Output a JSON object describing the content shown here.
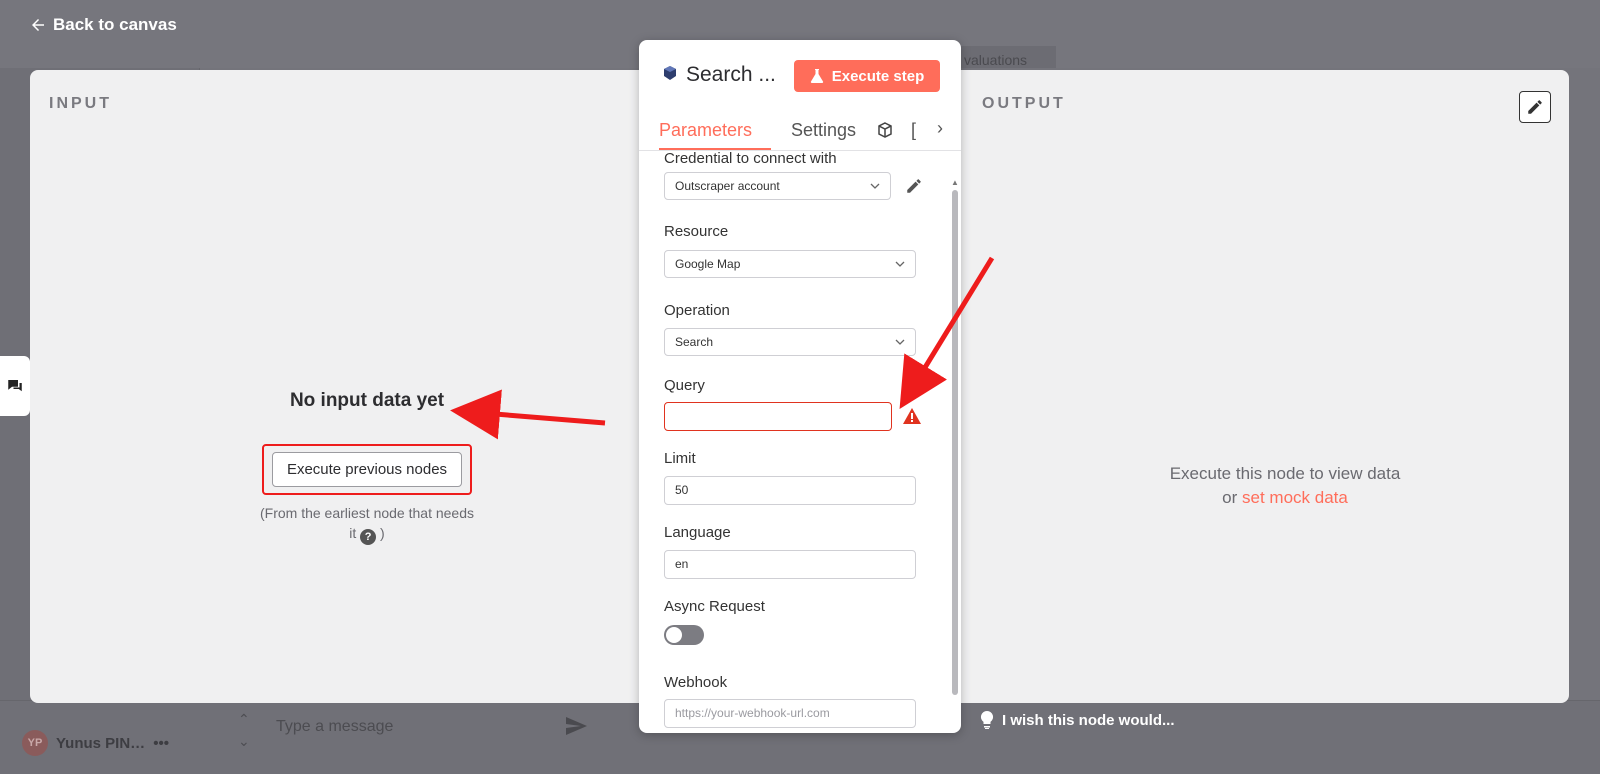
{
  "topbar": {
    "back_label": "Back to canvas",
    "behind_tab": "valuations"
  },
  "bottom": {
    "message_placeholder": "Type a message",
    "user_initials": "YP",
    "user_name": "Yunus PIN…"
  },
  "input_pane": {
    "label": "INPUT",
    "empty_title": "No input data yet",
    "execute_button": "Execute previous nodes",
    "hint_line1": "(From the earliest node that needs",
    "hint_line2_pre": "it",
    "hint_line2_post": ")",
    "help_icon_glyph": "?"
  },
  "output_pane": {
    "label": "OUTPUT",
    "empty_line1": "Execute this node to view data",
    "empty_or": "or",
    "mock_link": "set mock data"
  },
  "node": {
    "title": "Search ...",
    "execute_label": "Execute step",
    "tabs": [
      "Parameters",
      "Settings",
      "[",
      "›"
    ],
    "active_tab": "Parameters",
    "fields": {
      "credential": {
        "label": "Credential to connect with",
        "value": "Outscraper account"
      },
      "resource": {
        "label": "Resource",
        "value": "Google Map"
      },
      "operation": {
        "label": "Operation",
        "value": "Search"
      },
      "query": {
        "label": "Query",
        "value": ""
      },
      "limit": {
        "label": "Limit",
        "value": "50"
      },
      "language": {
        "label": "Language",
        "value": "en"
      },
      "async": {
        "label": "Async Request",
        "on": false
      },
      "webhook": {
        "label": "Webhook",
        "placeholder": "https://your-webhook-url.com"
      }
    }
  },
  "feedback": {
    "wish_label": "I wish this node would..."
  },
  "colors": {
    "accent": "#ff6d5a",
    "error": "#e0331f",
    "annotation": "#ee1c1c",
    "overlay": "#76767d"
  }
}
